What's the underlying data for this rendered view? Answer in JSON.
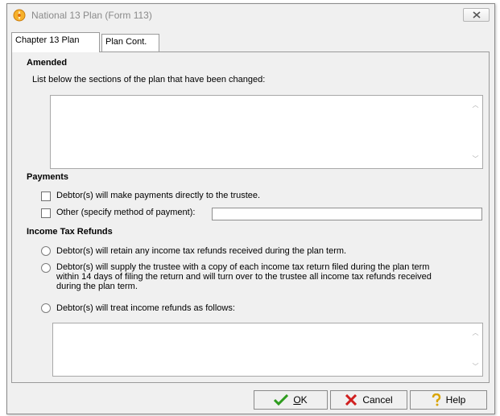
{
  "window": {
    "title": "National 13 Plan (Form 113)"
  },
  "tabs": [
    {
      "label": "Chapter 13 Plan",
      "active": true
    },
    {
      "label": "Plan Cont.",
      "active": false
    }
  ],
  "amended": {
    "heading": "Amended",
    "instruction": "List below the sections of the plan that have been changed:",
    "text_value": ""
  },
  "payments": {
    "heading": "Payments",
    "option1_label": "Debtor(s) will make payments directly to the trustee.",
    "option2_label": "Other (specify method of payment):",
    "other_value": ""
  },
  "income_tax": {
    "heading": "Income Tax Refunds",
    "option1": "Debtor(s) will retain any income tax refunds received during the plan term.",
    "option2_line1": "Debtor(s) will supply the trustee with a copy of each income tax return filed during the plan term",
    "option2_line2": "within 14 days of filing the return and will turn over to the trustee all income tax refunds received",
    "option2_line3": "during the plan term.",
    "option3": "Debtor(s) will treat income refunds as follows:",
    "text_value": ""
  },
  "buttons": {
    "ok_mnemonic": "O",
    "ok_rest": "K",
    "cancel": "Cancel",
    "help": "Help"
  },
  "colors": {
    "title_text": "#8a8a8a",
    "ok_check": "#2e9c1e",
    "cancel_x": "#d01f1f"
  }
}
